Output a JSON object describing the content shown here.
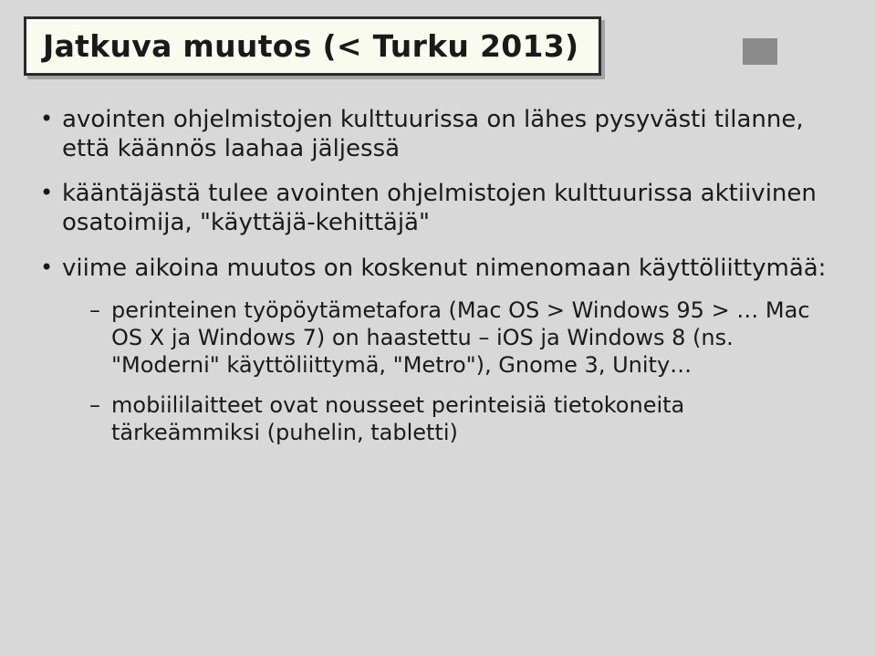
{
  "title": "Jatkuva muutos (< Turku 2013)",
  "bullets": [
    {
      "text": "avointen ohjelmistojen kulttuurissa on lähes pysyvästi tilanne, että käännös laahaa jäljessä"
    },
    {
      "text": "kääntäjästä tulee avointen ohjelmistojen kulttuurissa aktiivinen osatoimija, \"käyttäjä-kehittäjä\""
    },
    {
      "text": "viime aikoina muutos on koskenut nimenomaan käyttöliittymää:",
      "sub": [
        {
          "text": "perinteinen työpöytämetafora (Mac OS > Windows 95 > … Mac OS X ja Windows 7) on haastettu – iOS ja Windows 8 (ns. \"Moderni\" käyttöliittymä, \"Metro\"), Gnome 3, Unity…"
        },
        {
          "text": "mobiililaitteet ovat nousseet perinteisiä tietokoneita tärkeämmiksi (puhelin, tabletti)"
        }
      ]
    }
  ]
}
